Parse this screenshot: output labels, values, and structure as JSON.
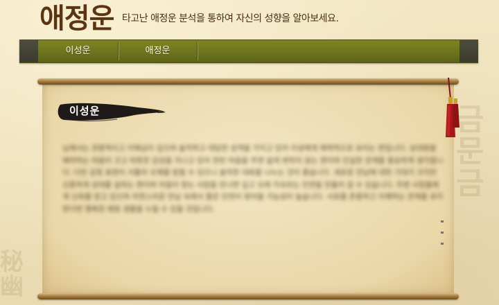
{
  "header": {
    "brand": "애정운",
    "tagline": "타고난 애정운 분석을 통하여 자신의 성향을 알아보세요."
  },
  "nav": {
    "items": [
      {
        "label": "이성운"
      },
      {
        "label": "애정운"
      }
    ]
  },
  "content": {
    "section_title": "이성운",
    "body": "님께서는 관용적이고 이해심이 깊으며 솔직하고 대담한 성격을 가지고 있어 이성에게 매력적으로 보이는 편입니다. 상대방을 배려하는 마음이 크고 따뜻한 감성을 지니고 있어 한번 마음을 주면 쉽게 변하지 않는 편이며 진실한 관계를 중요하게 생각합니다. 다만 감정 표현이 서툴러 오해를 받을 수 있으니 솔직한 대화를 나누는 것이 좋습니다. 새로운 만남에 대한 기대가 크지만 신중하게 상대를 살피는 편이며 마음이 맞는 사람을 만나면 깊고 오래 지속되는 인연을 만들어 갈 수 있습니다. 주변 사람들에게 신뢰를 얻고 있으며 자연스러운 만남 속에서 좋은 인연이 찾아올 가능성이 높습니다. 서로를 존중하고 이해하는 관계를 유지한다면 행복한 애정 생활을 누릴 수 있을 것입니다."
  },
  "colors": {
    "nav": "#72781f",
    "brand": "#5a3413",
    "paper": "#ead7a8",
    "brush": "#1f1a17"
  },
  "icons": {
    "tassel": "red-tassel-icon",
    "brush": "ink-brush-stroke"
  }
}
